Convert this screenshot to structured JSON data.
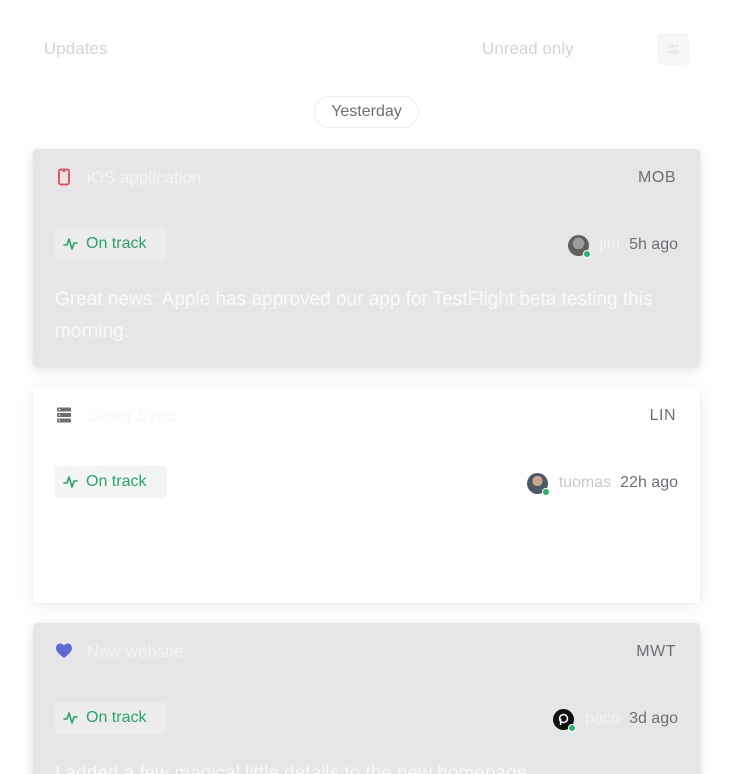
{
  "header": {
    "title": "Updates",
    "unread_toggle": "Unread only"
  },
  "day_group": {
    "label": "Yesterday"
  },
  "updates": [
    {
      "project": "iOS application",
      "team": "MOB",
      "status": "On track",
      "author": "jim",
      "time": "5h ago",
      "body": "Great news: Apple has approved our app for TestFlight beta testing this morning.",
      "icon": "phone-icon",
      "icon_color": "#e5484d"
    },
    {
      "project": "Super Sync",
      "team": "LIN",
      "status": "On track",
      "author": "tuomas",
      "time": "22h ago",
      "body": "",
      "icon": "server-icon",
      "icon_color": "#6b6f76"
    },
    {
      "project": "New website",
      "team": "MWT",
      "status": "On track",
      "author": "paco",
      "time": "3d ago",
      "body": "I added a few magical little details to the new homepage",
      "icon": "heart-icon",
      "icon_color": "#5e6ad2"
    }
  ],
  "colors": {
    "status_on_track": "#28a46b",
    "presence_online": "#26b46d",
    "muted_card": "#e6e6e6"
  }
}
